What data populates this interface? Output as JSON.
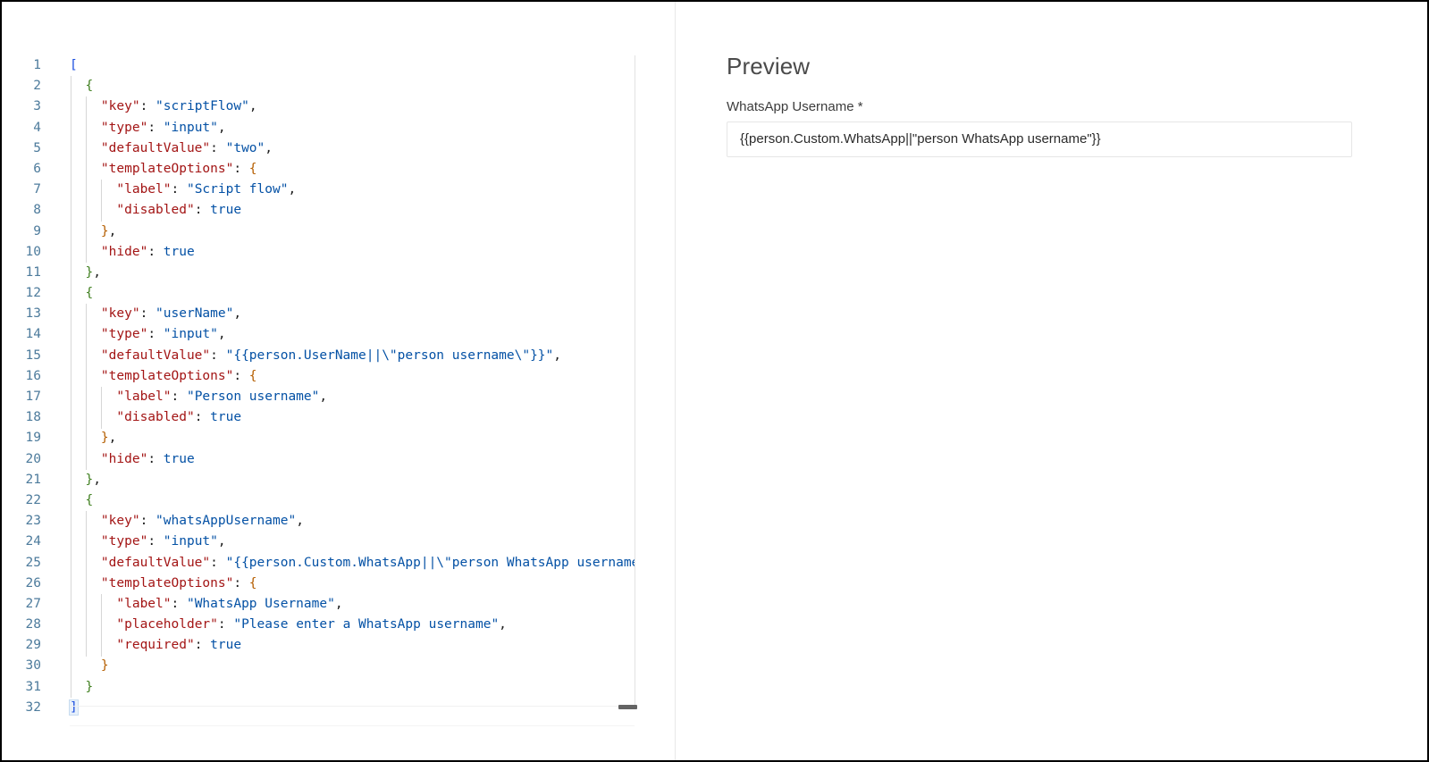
{
  "window": {
    "close_label": "×"
  },
  "editor": {
    "language": "json",
    "total_lines": 32,
    "lines": [
      {
        "n": "1",
        "tokens": [
          {
            "t": "br1",
            "v": "["
          }
        ]
      },
      {
        "n": "2",
        "tokens": [
          {
            "t": "plain",
            "v": "  "
          },
          {
            "t": "br2",
            "v": "{"
          }
        ]
      },
      {
        "n": "3",
        "tokens": [
          {
            "t": "plain",
            "v": "    "
          },
          {
            "t": "key",
            "v": "\"key\""
          },
          {
            "t": "punc",
            "v": ": "
          },
          {
            "t": "str",
            "v": "\"scriptFlow\""
          },
          {
            "t": "punc",
            "v": ","
          }
        ]
      },
      {
        "n": "4",
        "tokens": [
          {
            "t": "plain",
            "v": "    "
          },
          {
            "t": "key",
            "v": "\"type\""
          },
          {
            "t": "punc",
            "v": ": "
          },
          {
            "t": "str",
            "v": "\"input\""
          },
          {
            "t": "punc",
            "v": ","
          }
        ]
      },
      {
        "n": "5",
        "tokens": [
          {
            "t": "plain",
            "v": "    "
          },
          {
            "t": "key",
            "v": "\"defaultValue\""
          },
          {
            "t": "punc",
            "v": ": "
          },
          {
            "t": "str",
            "v": "\"two\""
          },
          {
            "t": "punc",
            "v": ","
          }
        ]
      },
      {
        "n": "6",
        "tokens": [
          {
            "t": "plain",
            "v": "    "
          },
          {
            "t": "key",
            "v": "\"templateOptions\""
          },
          {
            "t": "punc",
            "v": ": "
          },
          {
            "t": "br3",
            "v": "{"
          }
        ]
      },
      {
        "n": "7",
        "tokens": [
          {
            "t": "plain",
            "v": "      "
          },
          {
            "t": "key",
            "v": "\"label\""
          },
          {
            "t": "punc",
            "v": ": "
          },
          {
            "t": "str",
            "v": "\"Script flow\""
          },
          {
            "t": "punc",
            "v": ","
          }
        ]
      },
      {
        "n": "8",
        "tokens": [
          {
            "t": "plain",
            "v": "      "
          },
          {
            "t": "key",
            "v": "\"disabled\""
          },
          {
            "t": "punc",
            "v": ": "
          },
          {
            "t": "kw",
            "v": "true"
          }
        ]
      },
      {
        "n": "9",
        "tokens": [
          {
            "t": "plain",
            "v": "    "
          },
          {
            "t": "br3",
            "v": "}"
          },
          {
            "t": "punc",
            "v": ","
          }
        ]
      },
      {
        "n": "10",
        "tokens": [
          {
            "t": "plain",
            "v": "    "
          },
          {
            "t": "key",
            "v": "\"hide\""
          },
          {
            "t": "punc",
            "v": ": "
          },
          {
            "t": "kw",
            "v": "true"
          }
        ]
      },
      {
        "n": "11",
        "tokens": [
          {
            "t": "plain",
            "v": "  "
          },
          {
            "t": "br2",
            "v": "}"
          },
          {
            "t": "punc",
            "v": ","
          }
        ]
      },
      {
        "n": "12",
        "tokens": [
          {
            "t": "plain",
            "v": "  "
          },
          {
            "t": "br2",
            "v": "{"
          }
        ]
      },
      {
        "n": "13",
        "tokens": [
          {
            "t": "plain",
            "v": "    "
          },
          {
            "t": "key",
            "v": "\"key\""
          },
          {
            "t": "punc",
            "v": ": "
          },
          {
            "t": "str",
            "v": "\"userName\""
          },
          {
            "t": "punc",
            "v": ","
          }
        ]
      },
      {
        "n": "14",
        "tokens": [
          {
            "t": "plain",
            "v": "    "
          },
          {
            "t": "key",
            "v": "\"type\""
          },
          {
            "t": "punc",
            "v": ": "
          },
          {
            "t": "str",
            "v": "\"input\""
          },
          {
            "t": "punc",
            "v": ","
          }
        ]
      },
      {
        "n": "15",
        "tokens": [
          {
            "t": "plain",
            "v": "    "
          },
          {
            "t": "key",
            "v": "\"defaultValue\""
          },
          {
            "t": "punc",
            "v": ": "
          },
          {
            "t": "str",
            "v": "\"{{person.UserName||\\\"person username\\\"}}\""
          },
          {
            "t": "punc",
            "v": ","
          }
        ]
      },
      {
        "n": "16",
        "tokens": [
          {
            "t": "plain",
            "v": "    "
          },
          {
            "t": "key",
            "v": "\"templateOptions\""
          },
          {
            "t": "punc",
            "v": ": "
          },
          {
            "t": "br3",
            "v": "{"
          }
        ]
      },
      {
        "n": "17",
        "tokens": [
          {
            "t": "plain",
            "v": "      "
          },
          {
            "t": "key",
            "v": "\"label\""
          },
          {
            "t": "punc",
            "v": ": "
          },
          {
            "t": "str",
            "v": "\"Person username\""
          },
          {
            "t": "punc",
            "v": ","
          }
        ]
      },
      {
        "n": "18",
        "tokens": [
          {
            "t": "plain",
            "v": "      "
          },
          {
            "t": "key",
            "v": "\"disabled\""
          },
          {
            "t": "punc",
            "v": ": "
          },
          {
            "t": "kw",
            "v": "true"
          }
        ]
      },
      {
        "n": "19",
        "tokens": [
          {
            "t": "plain",
            "v": "    "
          },
          {
            "t": "br3",
            "v": "}"
          },
          {
            "t": "punc",
            "v": ","
          }
        ]
      },
      {
        "n": "20",
        "tokens": [
          {
            "t": "plain",
            "v": "    "
          },
          {
            "t": "key",
            "v": "\"hide\""
          },
          {
            "t": "punc",
            "v": ": "
          },
          {
            "t": "kw",
            "v": "true"
          }
        ]
      },
      {
        "n": "21",
        "tokens": [
          {
            "t": "plain",
            "v": "  "
          },
          {
            "t": "br2",
            "v": "}"
          },
          {
            "t": "punc",
            "v": ","
          }
        ]
      },
      {
        "n": "22",
        "tokens": [
          {
            "t": "plain",
            "v": "  "
          },
          {
            "t": "br2",
            "v": "{"
          }
        ]
      },
      {
        "n": "23",
        "tokens": [
          {
            "t": "plain",
            "v": "    "
          },
          {
            "t": "key",
            "v": "\"key\""
          },
          {
            "t": "punc",
            "v": ": "
          },
          {
            "t": "str",
            "v": "\"whatsAppUsername\""
          },
          {
            "t": "punc",
            "v": ","
          }
        ]
      },
      {
        "n": "24",
        "tokens": [
          {
            "t": "plain",
            "v": "    "
          },
          {
            "t": "key",
            "v": "\"type\""
          },
          {
            "t": "punc",
            "v": ": "
          },
          {
            "t": "str",
            "v": "\"input\""
          },
          {
            "t": "punc",
            "v": ","
          }
        ]
      },
      {
        "n": "25",
        "tokens": [
          {
            "t": "plain",
            "v": "    "
          },
          {
            "t": "key",
            "v": "\"defaultValue\""
          },
          {
            "t": "punc",
            "v": ": "
          },
          {
            "t": "str",
            "v": "\"{{person.Custom.WhatsApp||\\\"person WhatsApp username\\\"}}\""
          },
          {
            "t": "punc",
            "v": ","
          }
        ]
      },
      {
        "n": "26",
        "tokens": [
          {
            "t": "plain",
            "v": "    "
          },
          {
            "t": "key",
            "v": "\"templateOptions\""
          },
          {
            "t": "punc",
            "v": ": "
          },
          {
            "t": "br3",
            "v": "{"
          }
        ]
      },
      {
        "n": "27",
        "tokens": [
          {
            "t": "plain",
            "v": "      "
          },
          {
            "t": "key",
            "v": "\"label\""
          },
          {
            "t": "punc",
            "v": ": "
          },
          {
            "t": "str",
            "v": "\"WhatsApp Username\""
          },
          {
            "t": "punc",
            "v": ","
          }
        ]
      },
      {
        "n": "28",
        "tokens": [
          {
            "t": "plain",
            "v": "      "
          },
          {
            "t": "key",
            "v": "\"placeholder\""
          },
          {
            "t": "punc",
            "v": ": "
          },
          {
            "t": "str",
            "v": "\"Please enter a WhatsApp username\""
          },
          {
            "t": "punc",
            "v": ","
          }
        ]
      },
      {
        "n": "29",
        "tokens": [
          {
            "t": "plain",
            "v": "      "
          },
          {
            "t": "key",
            "v": "\"required\""
          },
          {
            "t": "punc",
            "v": ": "
          },
          {
            "t": "kw",
            "v": "true"
          }
        ]
      },
      {
        "n": "30",
        "tokens": [
          {
            "t": "plain",
            "v": "    "
          },
          {
            "t": "br3",
            "v": "}"
          }
        ]
      },
      {
        "n": "31",
        "tokens": [
          {
            "t": "plain",
            "v": "  "
          },
          {
            "t": "br2",
            "v": "}"
          }
        ]
      },
      {
        "n": "32",
        "tokens": [
          {
            "t": "br1",
            "v": "]",
            "hl": true
          }
        ]
      }
    ]
  },
  "preview": {
    "title": "Preview",
    "fields": [
      {
        "label": "WhatsApp Username *",
        "value": "{{person.Custom.WhatsApp||\"person WhatsApp username\"}}",
        "placeholder": "Please enter a WhatsApp username",
        "required": true
      }
    ]
  },
  "colors": {
    "key": "#a31515",
    "string": "#0451a5",
    "keyword": "#0451a5",
    "bracket_level1": "#1b4fe0",
    "bracket_level2": "#3f7f1f",
    "bracket_level3": "#b55e00",
    "line_number": "#4d7b9c",
    "divider": "#e8e8e8",
    "input_border": "#e6e6e6"
  }
}
